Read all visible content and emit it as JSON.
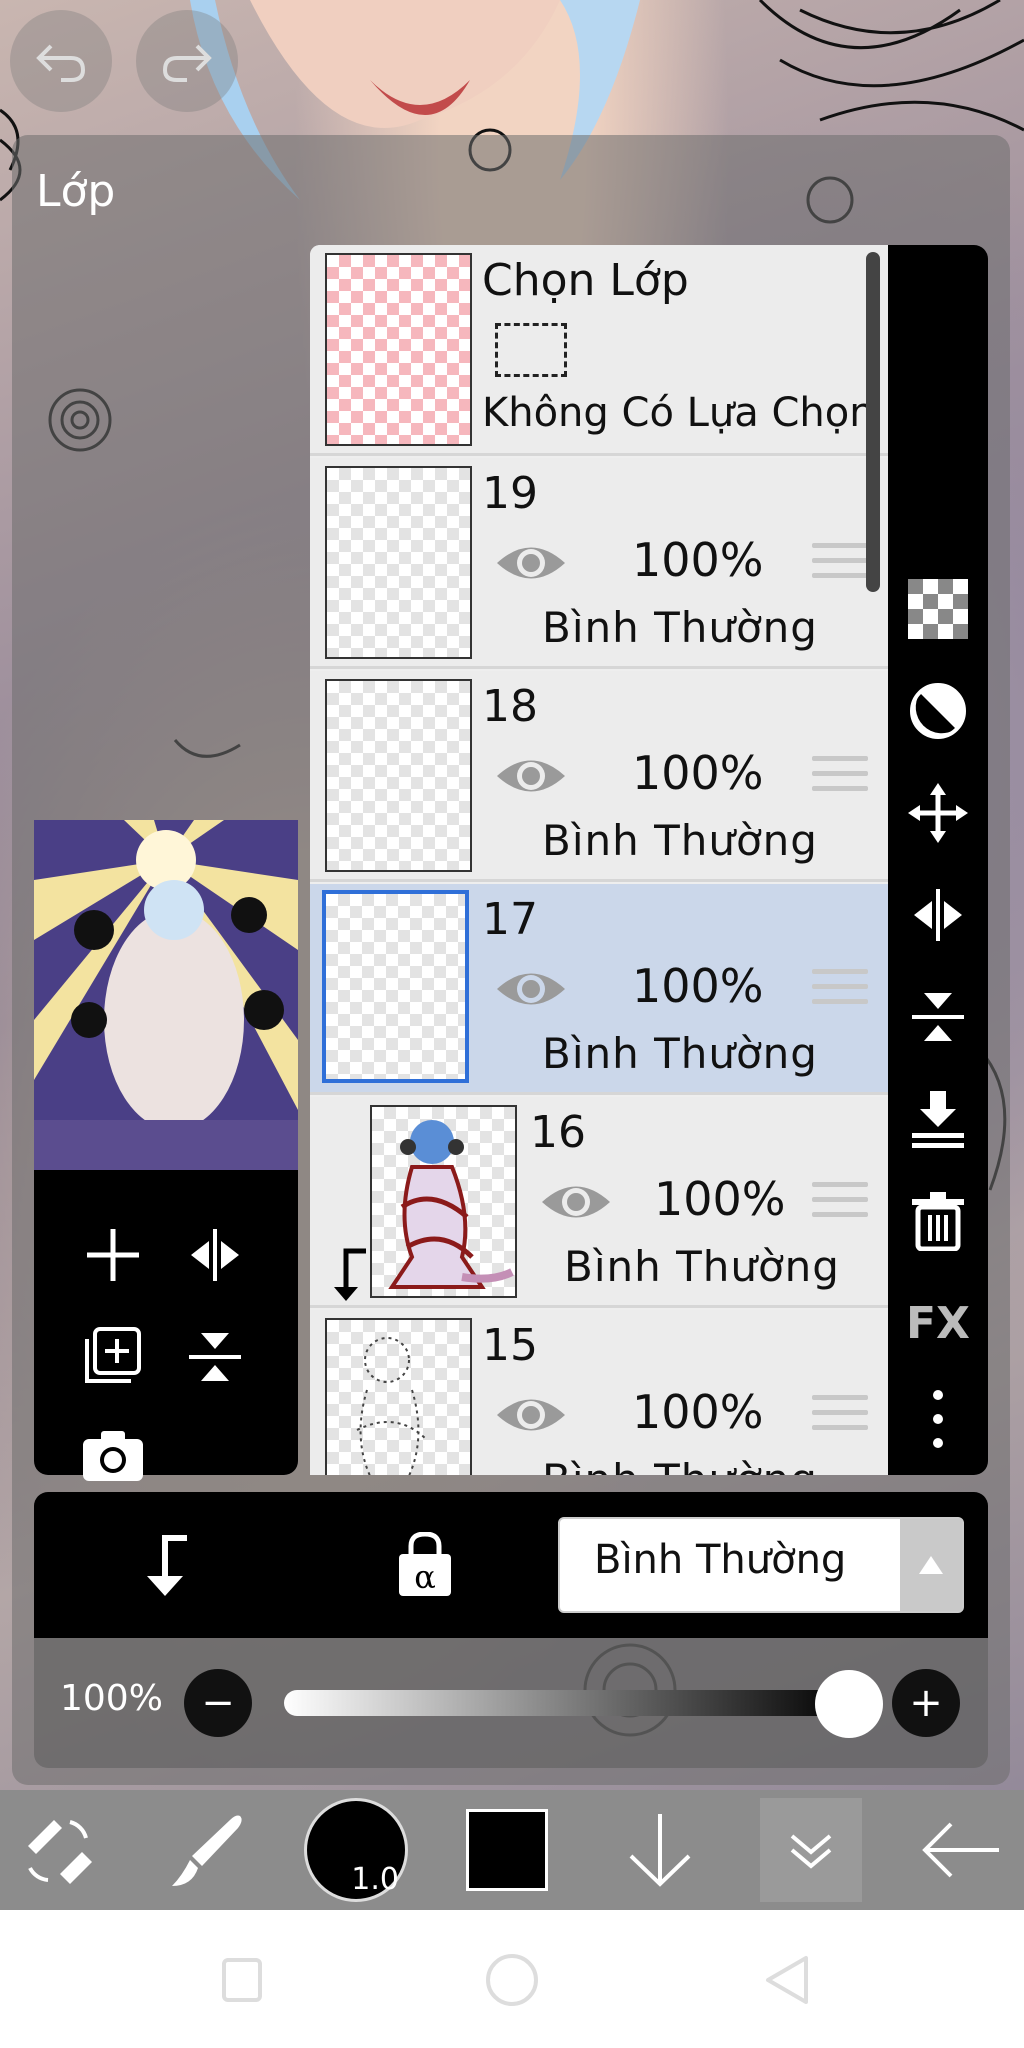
{
  "panel": {
    "title": "Lớp"
  },
  "selection_row": {
    "title": "Chọn Lớp",
    "subtitle": "Không Có Lựa Chọn"
  },
  "layers": [
    {
      "name": "19",
      "opacity": "100%",
      "blend": "Bình Thường",
      "selected": false,
      "clipped": false
    },
    {
      "name": "18",
      "opacity": "100%",
      "blend": "Bình Thường",
      "selected": false,
      "clipped": false
    },
    {
      "name": "17",
      "opacity": "100%",
      "blend": "Bình Thường",
      "selected": true,
      "clipped": false
    },
    {
      "name": "16",
      "opacity": "100%",
      "blend": "Bình Thường",
      "selected": false,
      "clipped": true
    },
    {
      "name": "15",
      "opacity": "100%",
      "blend": "Bình Thường",
      "selected": false,
      "clipped": false
    }
  ],
  "sidebar": {
    "fx_label": "FX",
    "icons": [
      "checker-icon",
      "half-circle-icon",
      "move-icon",
      "flip-horizontal-icon",
      "flip-vertical-icon",
      "merge-down-icon",
      "trash-icon",
      "fx",
      "more-vertical-icon"
    ]
  },
  "tools": {
    "icons": [
      "add-layer-icon",
      "flip-layer-icon",
      "duplicate-layer-icon",
      "merge-icon",
      "camera-icon"
    ]
  },
  "bottom_bar": {
    "blend_mode": "Bình Thường",
    "icons": [
      "clip-arrow-icon",
      "alpha-lock-icon"
    ]
  },
  "opacity": {
    "label": "100%",
    "value": 1.0
  },
  "toolbar": {
    "brush_size": "1.0",
    "color": "#000000"
  },
  "colors": {
    "accent": "#2f6fd8",
    "selected_row": "#cbd7ea",
    "transparent_thumb": "#f6b7bd"
  }
}
